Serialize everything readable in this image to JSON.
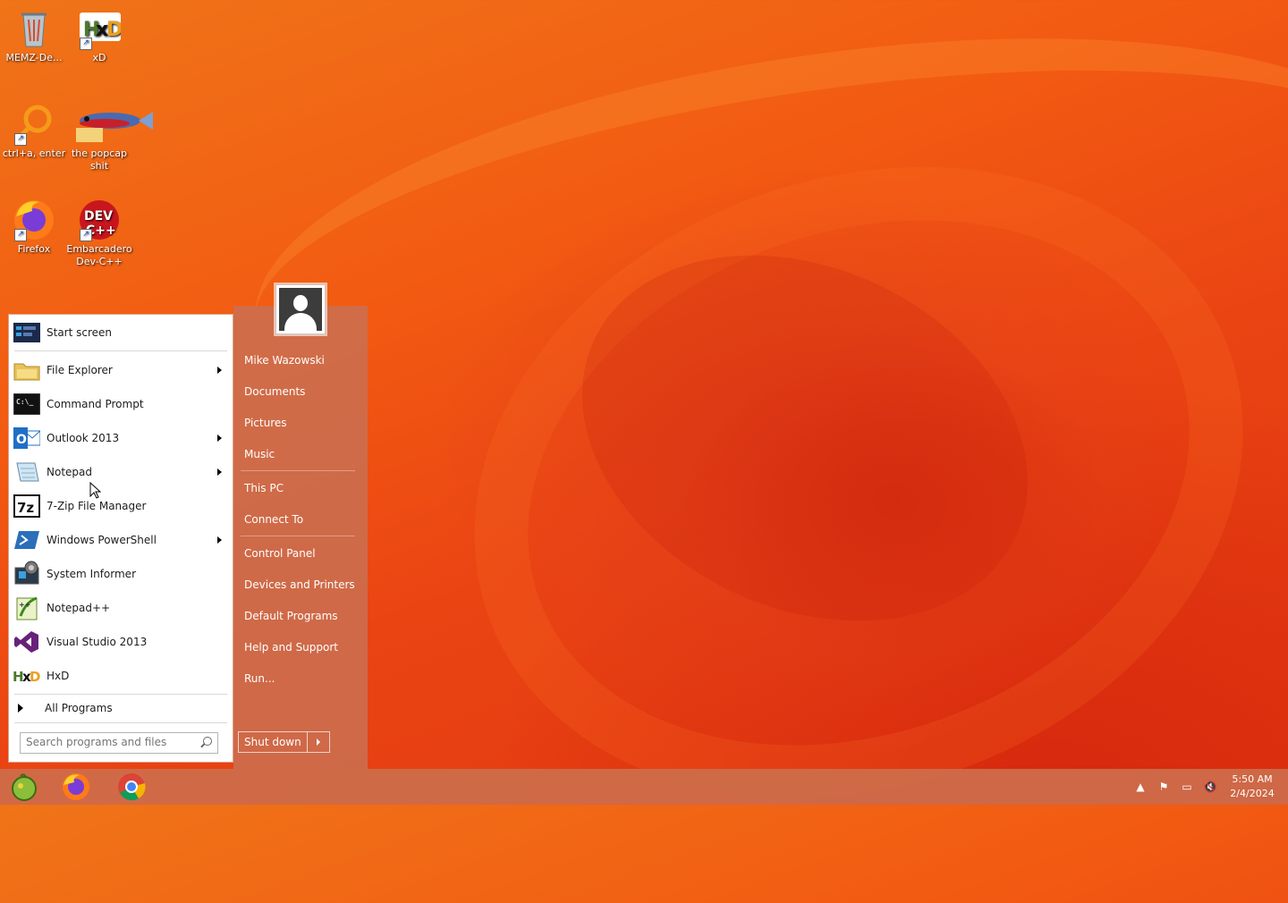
{
  "desktop": {
    "icons": [
      {
        "label": "MEMZ-De...",
        "icon": "recycle-bin-icon"
      },
      {
        "label": "xD",
        "icon": "hxd-icon"
      },
      {
        "label": "ctrl+a, enter",
        "icon": "search-ring-icon"
      },
      {
        "label": "the popcap shit",
        "icon": "fish-icon"
      },
      {
        "label": "Firefox",
        "icon": "firefox-icon"
      },
      {
        "label": "Embarcadero Dev-C++",
        "icon": "devcpp-icon"
      }
    ]
  },
  "start_menu": {
    "pinned": [
      {
        "label": "Start screen",
        "icon": "start-screen-icon",
        "has_submenu": false
      },
      {
        "label": "File Explorer",
        "icon": "folder-icon",
        "has_submenu": true
      },
      {
        "label": "Command Prompt",
        "icon": "cmd-icon",
        "has_submenu": false
      },
      {
        "label": "Outlook 2013",
        "icon": "outlook-icon",
        "has_submenu": true
      },
      {
        "label": "Notepad",
        "icon": "notepad-icon",
        "has_submenu": true
      },
      {
        "label": "7-Zip File Manager",
        "icon": "7zip-icon",
        "has_submenu": false
      },
      {
        "label": "Windows PowerShell",
        "icon": "powershell-icon",
        "has_submenu": true
      },
      {
        "label": "System Informer",
        "icon": "system-informer-icon",
        "has_submenu": false
      },
      {
        "label": "Notepad++",
        "icon": "notepadpp-icon",
        "has_submenu": false
      },
      {
        "label": "Visual Studio 2013",
        "icon": "visual-studio-icon",
        "has_submenu": false
      },
      {
        "label": "HxD",
        "icon": "hxd-icon",
        "has_submenu": false
      }
    ],
    "all_programs": "All Programs",
    "search_placeholder": "Search programs and files",
    "right": {
      "user": "Mike Wazowski",
      "documents": "Documents",
      "pictures": "Pictures",
      "music": "Music",
      "this_pc": "This PC",
      "connect_to": "Connect To",
      "control_panel": "Control Panel",
      "devices_printers": "Devices and Printers",
      "default_programs": "Default Programs",
      "help_support": "Help and Support",
      "run": "Run..."
    },
    "shutdown_label": "Shut down"
  },
  "taskbar": {
    "pinned": [
      "start-orb-icon",
      "firefox-icon",
      "chrome-icon"
    ],
    "clock": {
      "time": "5:50 AM",
      "date": "2/4/2024"
    }
  }
}
